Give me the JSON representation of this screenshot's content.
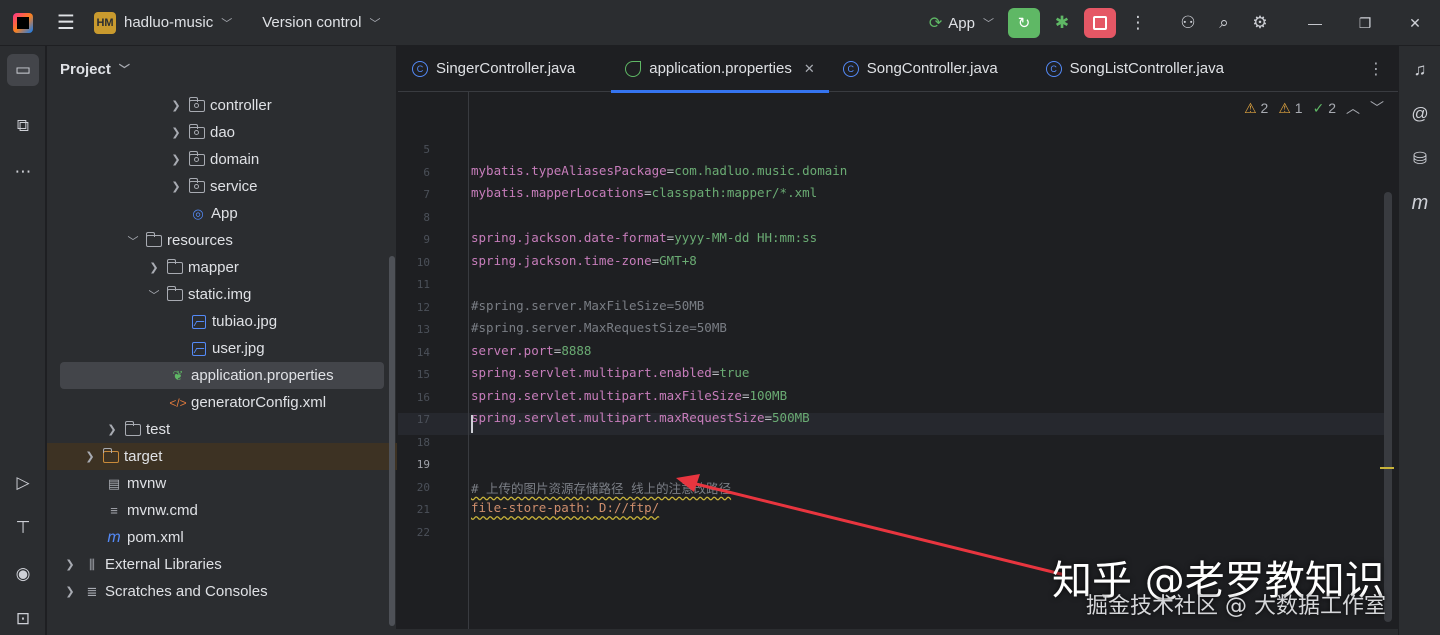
{
  "titlebar": {
    "project_badge": "HM",
    "project_name": "hadluo-music",
    "version_control": "Version control",
    "run_config": "App"
  },
  "project_panel": {
    "title": "Project",
    "tree": [
      {
        "label": "controller",
        "kind": "package",
        "expandable": true,
        "expanded": false
      },
      {
        "label": "dao",
        "kind": "package",
        "expandable": true,
        "expanded": false
      },
      {
        "label": "domain",
        "kind": "package",
        "expandable": true,
        "expanded": false
      },
      {
        "label": "service",
        "kind": "package",
        "expandable": true,
        "expanded": false
      },
      {
        "label": "App",
        "kind": "spring-class"
      },
      {
        "label": "resources",
        "kind": "resources-folder",
        "expandable": true,
        "expanded": true
      },
      {
        "label": "mapper",
        "kind": "folder",
        "expandable": true,
        "expanded": false
      },
      {
        "label": "static.img",
        "kind": "folder",
        "expandable": true,
        "expanded": true
      },
      {
        "label": "tubiao.jpg",
        "kind": "image"
      },
      {
        "label": "user.jpg",
        "kind": "image"
      },
      {
        "label": "application.properties",
        "kind": "properties",
        "selected": true
      },
      {
        "label": "generatorConfig.xml",
        "kind": "xml"
      },
      {
        "label": "test",
        "kind": "folder",
        "expandable": true,
        "expanded": false
      },
      {
        "label": "target",
        "kind": "folder",
        "expandable": true,
        "expanded": false,
        "excluded": true
      },
      {
        "label": "mvnw",
        "kind": "script"
      },
      {
        "label": "mvnw.cmd",
        "kind": "text"
      },
      {
        "label": "pom.xml",
        "kind": "maven"
      },
      {
        "label": "External Libraries",
        "kind": "libraries",
        "expandable": true,
        "expanded": false
      },
      {
        "label": "Scratches and Consoles",
        "kind": "scratches",
        "expandable": true,
        "expanded": false
      }
    ]
  },
  "tabs": [
    {
      "label": "SingerController.java",
      "icon": "class-icon",
      "active": false
    },
    {
      "label": "application.properties",
      "icon": "spring-leaf-icon",
      "active": true
    },
    {
      "label": "SongController.java",
      "icon": "class-icon",
      "active": false
    },
    {
      "label": "SongListController.java",
      "icon": "class-icon",
      "active": false
    }
  ],
  "inspections": {
    "warnings": "2",
    "weak_warnings": "1",
    "ok": "2"
  },
  "editor": {
    "current_line": "19",
    "lines": [
      {
        "n": "5",
        "key": "",
        "val": "",
        "comment": ""
      },
      {
        "n": "6",
        "key": "mybatis.typeAliasesPackage",
        "val": "com.hadluo.music.domain",
        "comment": ""
      },
      {
        "n": "7",
        "key": "mybatis.mapperLocations",
        "val": "classpath:mapper/*.xml",
        "comment": ""
      },
      {
        "n": "8",
        "key": "",
        "val": "",
        "comment": ""
      },
      {
        "n": "9",
        "key": "spring.jackson.date-format",
        "val": "yyyy-MM-dd HH:mm:ss",
        "comment": ""
      },
      {
        "n": "10",
        "key": "spring.jackson.time-zone",
        "val": "GMT+8",
        "comment": ""
      },
      {
        "n": "11",
        "key": "",
        "val": "",
        "comment": ""
      },
      {
        "n": "12",
        "key": "",
        "val": "",
        "comment": "#spring.server.MaxFileSize=50MB"
      },
      {
        "n": "13",
        "key": "",
        "val": "",
        "comment": "#spring.server.MaxRequestSize=50MB"
      },
      {
        "n": "14",
        "key": "server.port",
        "val": "8888",
        "comment": ""
      },
      {
        "n": "15",
        "key": "spring.servlet.multipart.enabled",
        "val": "true",
        "comment": ""
      },
      {
        "n": "16",
        "key": "spring.servlet.multipart.maxFileSize",
        "val": "100MB",
        "comment": ""
      },
      {
        "n": "17",
        "key": "spring.servlet.multipart.maxRequestSize",
        "val": "500MB",
        "comment": ""
      },
      {
        "n": "18",
        "key": "",
        "val": "",
        "comment": ""
      },
      {
        "n": "19",
        "key": "",
        "val": "",
        "comment": ""
      },
      {
        "n": "20",
        "key": "",
        "val": "",
        "comment": "# 上传的图片资源存储路径 线上的注意改路径"
      },
      {
        "n": "21",
        "key": "",
        "val": "",
        "comment": "",
        "raw": "file-store-path: D://ftp/"
      },
      {
        "n": "22",
        "key": "",
        "val": "",
        "comment": ""
      }
    ]
  },
  "watermark": {
    "line1": "知乎 @老罗教知识",
    "line2": "掘金技术社区 @ 大数据工作室"
  },
  "colors": {
    "accent": "#3574f0",
    "run_green": "#5fb865",
    "stop_red": "#e55765",
    "property_key": "#c77dbb",
    "property_value": "#6aab73",
    "annotation_arrow": "#e8353f"
  }
}
